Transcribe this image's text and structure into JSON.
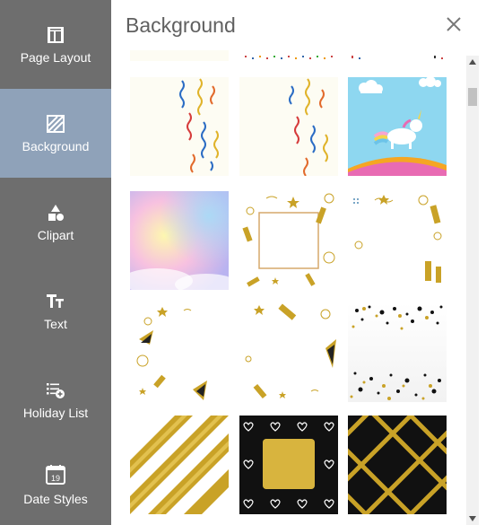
{
  "sidebar": {
    "items": [
      {
        "label": "Page Layout",
        "icon": "page-layout-icon"
      },
      {
        "label": "Background",
        "icon": "background-icon",
        "active": true
      },
      {
        "label": "Clipart",
        "icon": "clipart-icon"
      },
      {
        "label": "Text",
        "icon": "text-icon"
      },
      {
        "label": "Holiday List",
        "icon": "holiday-list-icon"
      },
      {
        "label": "Date Styles",
        "icon": "date-styles-icon",
        "badge": "19"
      }
    ]
  },
  "panel": {
    "title": "Background",
    "close_icon": "close-icon"
  },
  "backgrounds": [
    "partial-confetti-1",
    "partial-confetti-2",
    "partial-confetti-3",
    "streamers-1",
    "streamers-2",
    "unicorn-rainbow",
    "pastel-sky",
    "gold-frame-party",
    "gold-party-corners",
    "gold-party-hats-1",
    "gold-party-hats-2",
    "black-gold-confetti",
    "gold-glitter-stripes",
    "gold-hearts-black",
    "gold-diamond-lattice"
  ],
  "colors": {
    "sidebar_bg": "#6e6e6e",
    "sidebar_active": "#8fa2b9",
    "gold": "#c9a227",
    "sky": "#8ed7f0"
  }
}
